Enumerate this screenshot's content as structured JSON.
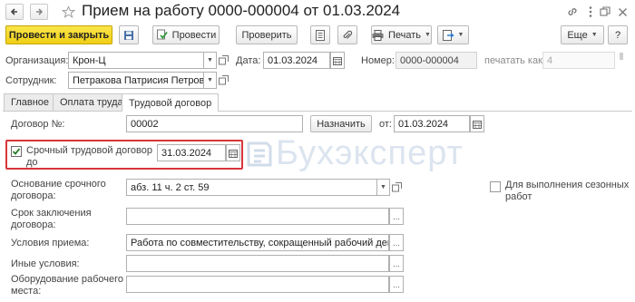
{
  "window": {
    "title": "Прием на работу 0000-000004 от 01.03.2024"
  },
  "toolbar": {
    "post_close": "Провести и закрыть",
    "post": "Провести",
    "check": "Проверить",
    "print": "Печать",
    "more": "Еще",
    "help": "?"
  },
  "header": {
    "org_label": "Организация:",
    "org_value": "Крон-Ц",
    "date_label": "Дата:",
    "date_value": "01.03.2024",
    "number_label": "Номер:",
    "number_value": "0000-000004",
    "print_as_label": "печатать как:",
    "print_as_value": "4",
    "employee_label": "Сотрудник:",
    "employee_value": "Петракова Патрисия Петровна"
  },
  "tabs": [
    {
      "label": "Главное"
    },
    {
      "label": "Оплата труда"
    },
    {
      "label": "Трудовой договор"
    }
  ],
  "contract": {
    "contract_label": "Договор №:",
    "contract_value": "00002",
    "assign_button": "Назначить",
    "from_label": "от:",
    "from_value": "01.03.2024",
    "fixed_term_label_1": "Срочный трудовой договор",
    "fixed_term_label_2": "до",
    "fixed_term_checked": true,
    "fixed_term_until": "31.03.2024",
    "basis_label_1": "Основание срочного",
    "basis_label_2": "договора:",
    "basis_value": "абз. 11 ч. 2 ст. 59",
    "seasonal_label_1": "Для выполнения сезонных",
    "seasonal_label_2": "работ",
    "seasonal_checked": false,
    "term_label_1": "Срок заключения",
    "term_label_2": "договора:",
    "term_value": "",
    "conditions_label": "Условия приема:",
    "conditions_value": "Работа по совместительству, сокращенный рабочий день",
    "other_label": "Иные условия:",
    "other_value": "",
    "equipment_label_1": "Оборудование рабочего",
    "equipment_label_2": "места:",
    "equipment_value": ""
  },
  "watermark": "Бухэксперт",
  "icons": {
    "back": "arrow-left-icon",
    "forward": "arrow-right-icon",
    "favorite": "star-icon",
    "link": "link-icon",
    "menu": "more-vertical-icon",
    "restore": "restore-window-icon",
    "close": "close-icon"
  }
}
